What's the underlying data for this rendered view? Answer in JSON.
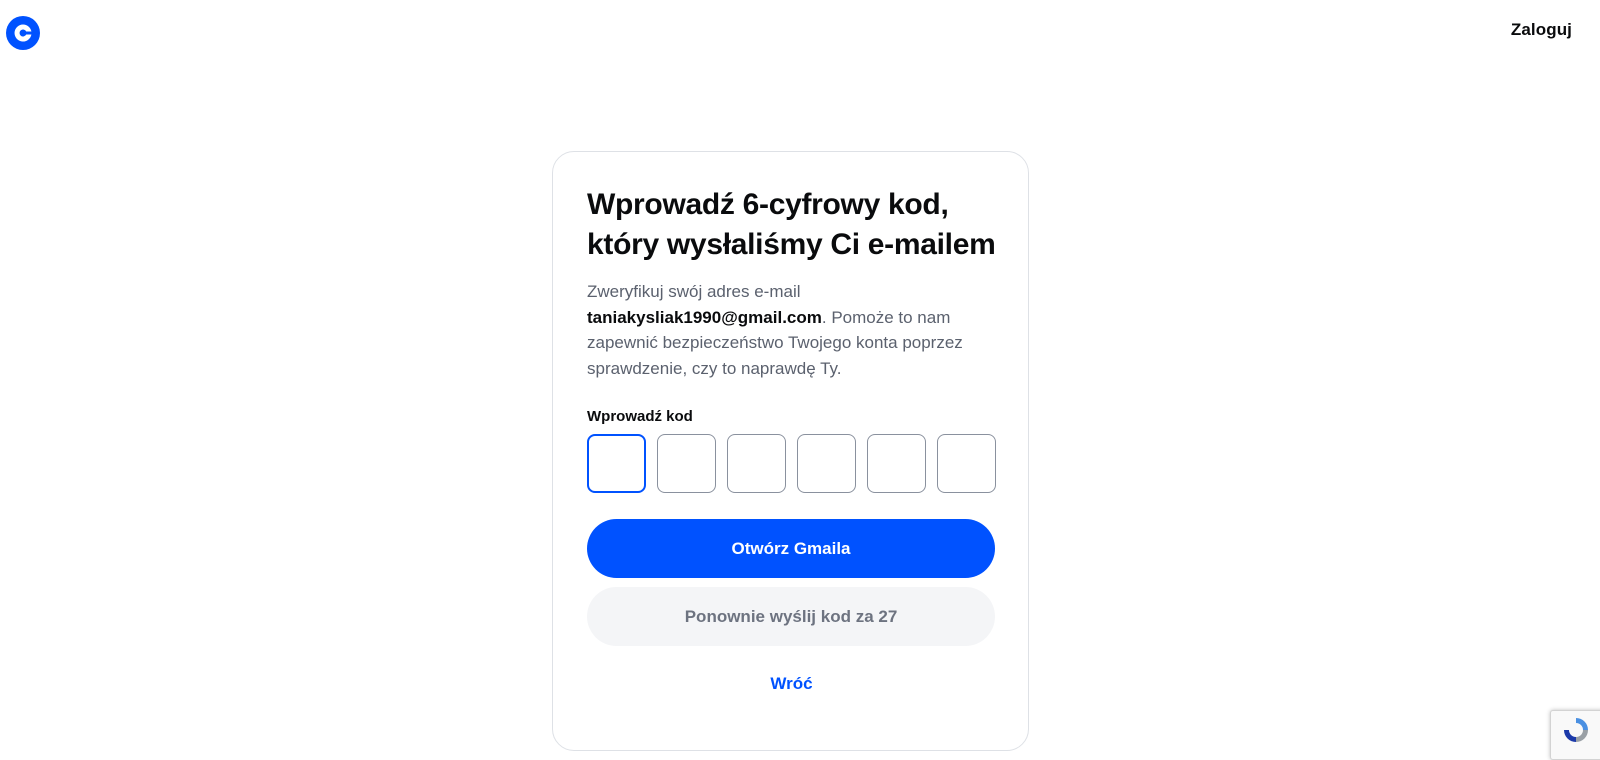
{
  "header": {
    "logo_icon": "coinbase-logo-icon",
    "login_label": "Zaloguj"
  },
  "card": {
    "title_line1": "Wprowadź 6-cyfrowy kod,",
    "title_line2": "który wysłaliśmy Ci e-mailem",
    "desc_prefix": "Zweryfikuj swój adres e-mail ",
    "desc_email": "taniakysliak1990@gmail.com",
    "desc_suffix": ". Pomoże to nam zapewnić bezpieczeństwo Twojego konta poprzez sprawdzenie, czy to naprawdę Ty.",
    "code_label": "Wprowadź kod",
    "code_digits": [
      "",
      "",
      "",
      "",
      "",
      ""
    ],
    "open_gmail_label": "Otwórz Gmaila",
    "resend_label": "Ponownie wyślij kod za 27",
    "back_label": "Wróć"
  },
  "colors": {
    "accent": "#0052FF",
    "text": "#0A0B0D",
    "muted": "#5B616E",
    "secondary_bg": "#F4F5F7"
  },
  "recaptcha": {
    "icon": "recaptcha-icon"
  }
}
